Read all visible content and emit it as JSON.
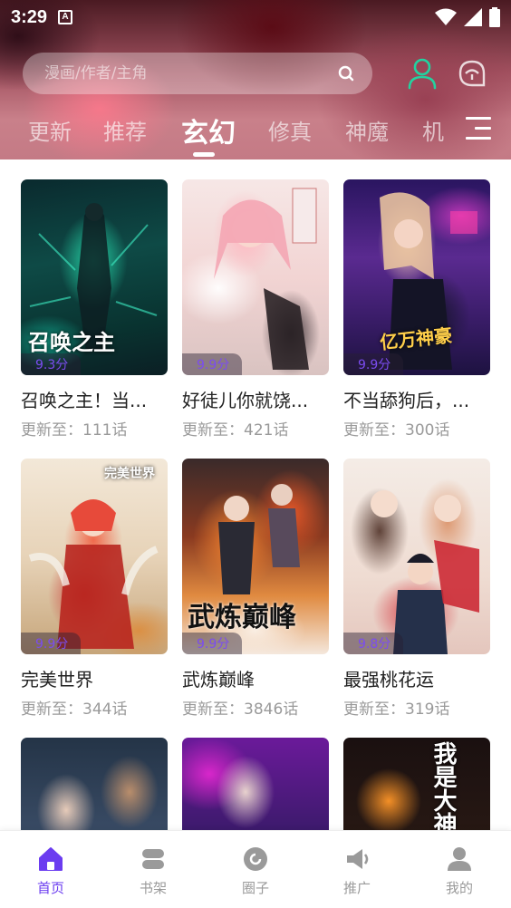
{
  "status_bar": {
    "time": "3:29",
    "notification_glyph": "A"
  },
  "search": {
    "placeholder": "漫画/作者/主角"
  },
  "tabs": [
    {
      "label": "更新",
      "active": false
    },
    {
      "label": "推荐",
      "active": false
    },
    {
      "label": "玄幻",
      "active": true
    },
    {
      "label": "修真",
      "active": false
    },
    {
      "label": "神魔",
      "active": false
    },
    {
      "label": "机",
      "active": false
    }
  ],
  "colors": {
    "accent": "#6b3cf0",
    "user_icon": "#22d3a0",
    "score": "#7b4cf0"
  },
  "comics": [
    {
      "title": "召唤之主！当...",
      "update": "更新至：111话",
      "score": "9.3分",
      "cover_text": "召唤之主"
    },
    {
      "title": "好徒儿你就饶...",
      "update": "更新至：421话",
      "score": "9.9分",
      "cover_text": ""
    },
    {
      "title": "不当舔狗后，...",
      "update": "更新至：300话",
      "score": "9.9分",
      "cover_text": "亿万神豪"
    },
    {
      "title": "完美世界",
      "update": "更新至：344话",
      "score": "9.9分",
      "cover_text": "完美世界"
    },
    {
      "title": "武炼巅峰",
      "update": "更新至：3846话",
      "score": "9.9分",
      "cover_text": "武炼巅峰"
    },
    {
      "title": "最强桃花运",
      "update": "更新至：319话",
      "score": "9.8分",
      "cover_text": ""
    },
    {
      "title": "",
      "update": "",
      "score": "",
      "cover_text": ""
    },
    {
      "title": "",
      "update": "",
      "score": "",
      "cover_text": ""
    },
    {
      "title": "",
      "update": "",
      "score": "",
      "cover_text": "我是大神"
    }
  ],
  "bottom_nav": [
    {
      "label": "首页",
      "icon": "home-icon",
      "active": true
    },
    {
      "label": "书架",
      "icon": "bookshelf-icon",
      "active": false
    },
    {
      "label": "圈子",
      "icon": "circle-icon",
      "active": false
    },
    {
      "label": "推广",
      "icon": "megaphone-icon",
      "active": false
    },
    {
      "label": "我的",
      "icon": "profile-icon",
      "active": false
    }
  ]
}
